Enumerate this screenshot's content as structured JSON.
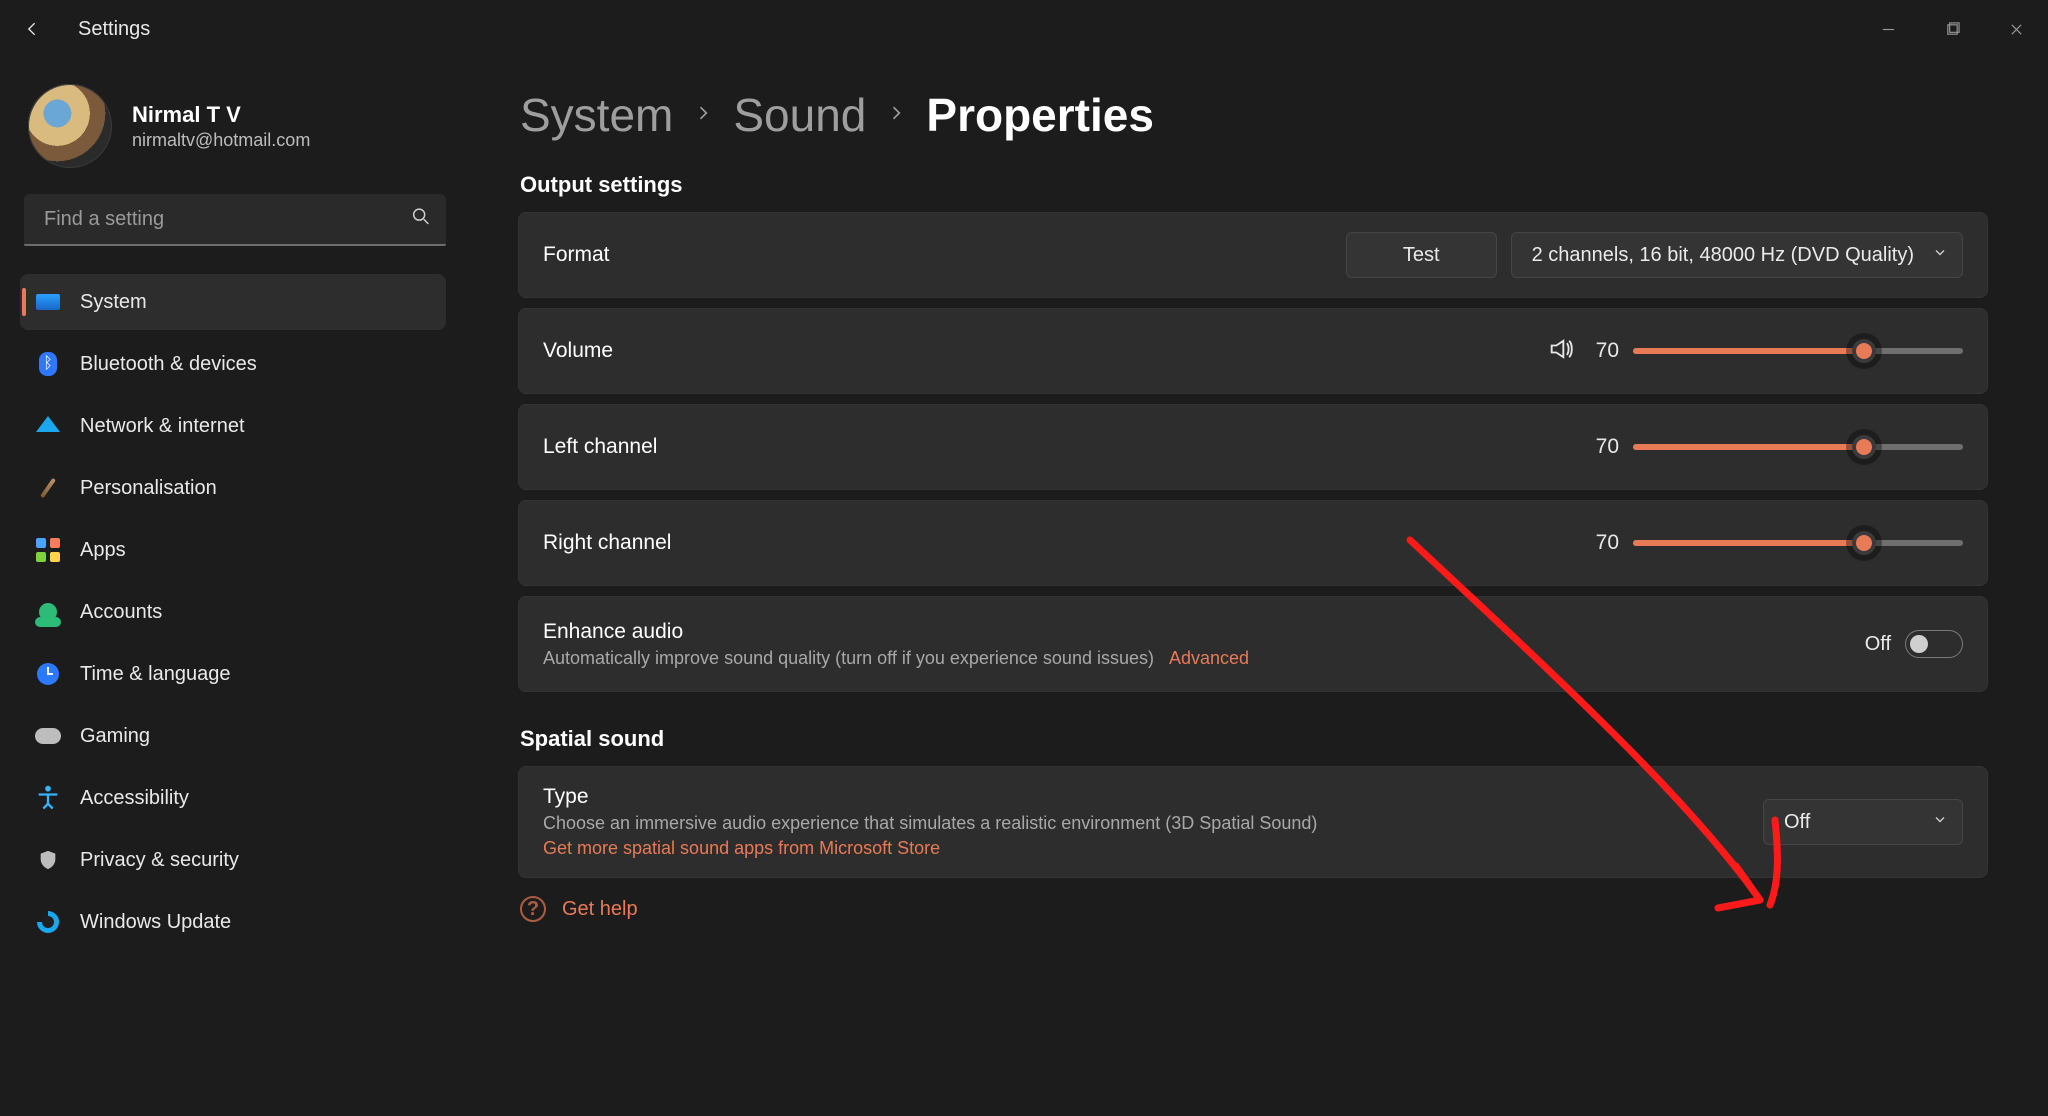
{
  "window": {
    "app_title": "Settings"
  },
  "user": {
    "name": "Nirmal T V",
    "email": "nirmaltv@hotmail.com"
  },
  "search": {
    "placeholder": "Find a setting"
  },
  "sidebar": {
    "items": [
      {
        "label": "System"
      },
      {
        "label": "Bluetooth & devices"
      },
      {
        "label": "Network & internet"
      },
      {
        "label": "Personalisation"
      },
      {
        "label": "Apps"
      },
      {
        "label": "Accounts"
      },
      {
        "label": "Time & language"
      },
      {
        "label": "Gaming"
      },
      {
        "label": "Accessibility"
      },
      {
        "label": "Privacy & security"
      },
      {
        "label": "Windows Update"
      }
    ],
    "active_index": 0
  },
  "breadcrumbs": {
    "a": "System",
    "b": "Sound",
    "c": "Properties"
  },
  "output": {
    "section_title": "Output settings",
    "format_label": "Format",
    "format_test": "Test",
    "format_value": "2 channels, 16 bit, 48000 Hz (DVD Quality)",
    "volume_label": "Volume",
    "volume_value": "70",
    "volume_percent": 70,
    "left_label": "Left channel",
    "left_value": "70",
    "left_percent": 70,
    "right_label": "Right channel",
    "right_value": "70",
    "right_percent": 70,
    "enhance_label": "Enhance audio",
    "enhance_sub": "Automatically improve sound quality (turn off if you experience sound issues)",
    "enhance_advanced": "Advanced",
    "enhance_state": "Off"
  },
  "spatial": {
    "section_title": "Spatial sound",
    "type_label": "Type",
    "type_sub": "Choose an immersive audio experience that simulates a realistic environment (3D Spatial Sound)",
    "store_link": "Get more spatial sound apps from Microsoft Store",
    "type_value": "Off"
  },
  "help": {
    "label": "Get help"
  },
  "colors": {
    "accent": "#e97a56"
  }
}
